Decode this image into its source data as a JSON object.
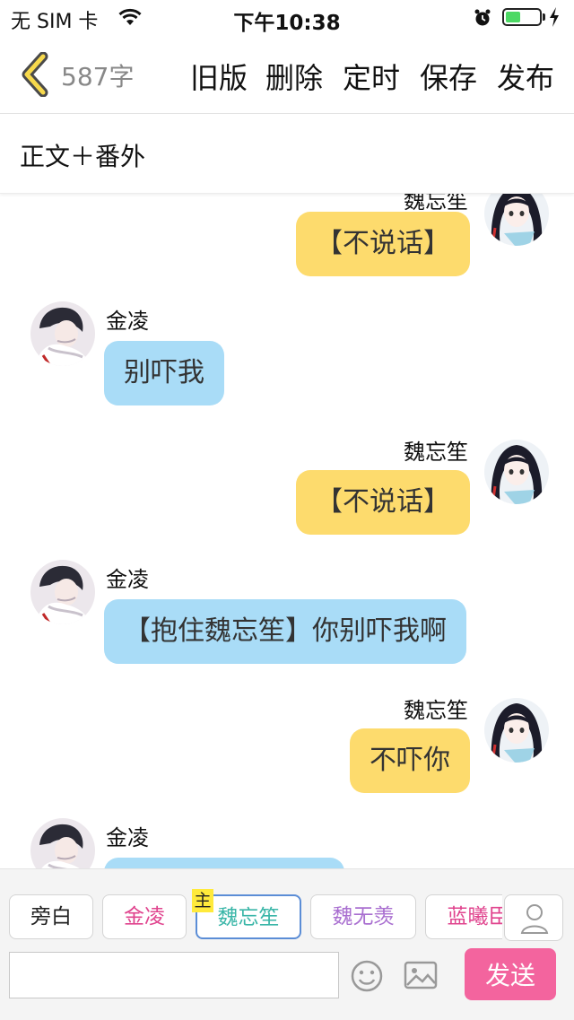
{
  "status_bar": {
    "carrier": "无 SIM 卡",
    "time": "下午10:38",
    "battery_level": 0.45
  },
  "nav": {
    "word_count": "587字",
    "actions": [
      "旧版",
      "删除",
      "定时",
      "保存",
      "发布"
    ]
  },
  "section": {
    "title": "正文＋番外"
  },
  "messages": [
    {
      "speaker": "魏忘笙",
      "side": "right",
      "text": "【不说话】",
      "color": "#fddb6d"
    },
    {
      "speaker": "金凌",
      "side": "left",
      "text": "别吓我",
      "color": "#a9dcf7"
    },
    {
      "speaker": "魏忘笙",
      "side": "right",
      "text": "【不说话】",
      "color": "#fddb6d"
    },
    {
      "speaker": "金凌",
      "side": "left",
      "text": "【抱住魏忘笙】你别吓我啊",
      "color": "#a9dcf7"
    },
    {
      "speaker": "魏忘笙",
      "side": "right",
      "text": "不吓你",
      "color": "#fddb6d"
    },
    {
      "speaker": "金凌",
      "side": "left",
      "text": "",
      "color": "#a9dcf7"
    }
  ],
  "characters": [
    {
      "label": "旁白",
      "color": "#222222"
    },
    {
      "label": "金凌",
      "color": "#e0448e"
    },
    {
      "label": "魏忘笙",
      "color": "#3ab6a8",
      "selected": true
    },
    {
      "label": "魏无羡",
      "color": "#a96fd0"
    },
    {
      "label": "蓝曦臣",
      "color": "#e0448e"
    }
  ],
  "main_tag": "主",
  "input": {
    "value": "",
    "placeholder": ""
  },
  "send_label": "发送",
  "colors": {
    "accent": "#f3649e",
    "yellow_bubble": "#fddb6d",
    "blue_bubble": "#a9dcf7",
    "selected_border": "#5b8dd6"
  },
  "icons": [
    "wifi-icon",
    "alarm-icon",
    "battery-icon",
    "charging-bolt-icon",
    "back-chevron-icon",
    "person-icon",
    "emoji-icon",
    "image-icon"
  ]
}
